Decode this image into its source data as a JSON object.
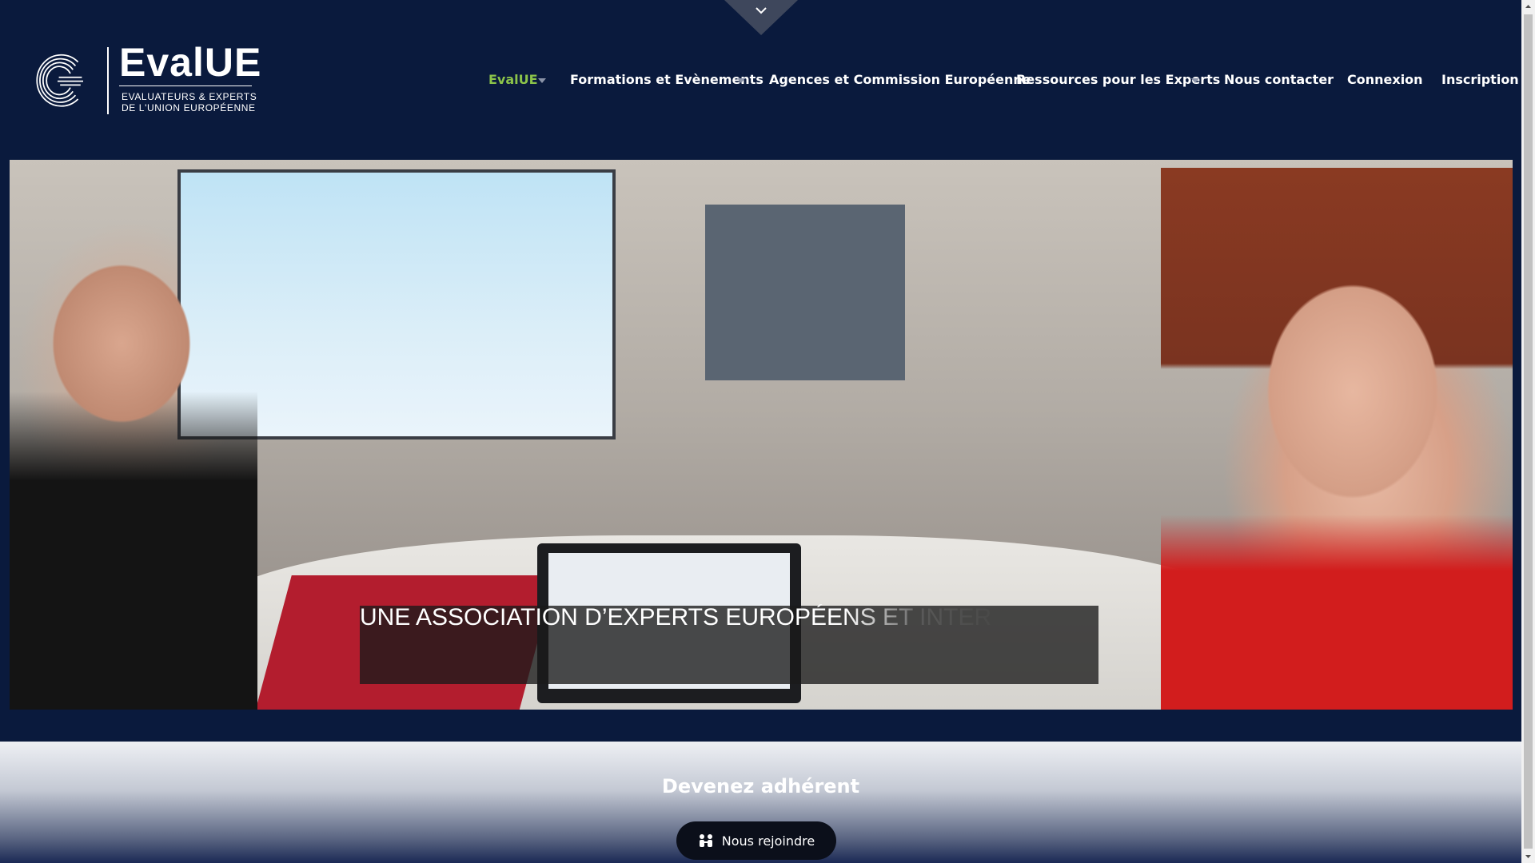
{
  "header": {
    "logo": {
      "name": "EvalUE",
      "line1": "EVALUATEURS & EXPERTS",
      "line2": "DE L'UNION EUROPÉENNE"
    },
    "nav": [
      {
        "label": "EvalUE",
        "active": true,
        "has_submenu": true
      },
      {
        "label": "Formations et Evènements",
        "active": false,
        "has_submenu": true
      },
      {
        "label": "Agences et Commission Européenne",
        "active": false,
        "has_submenu": false
      },
      {
        "label": "Ressources pour les Experts",
        "active": false,
        "has_submenu": true
      },
      {
        "label": "Nous contacter",
        "active": false,
        "has_submenu": false
      },
      {
        "label": "Connexion",
        "active": false,
        "has_submenu": false
      },
      {
        "label": "Inscription",
        "active": false,
        "has_submenu": false
      }
    ]
  },
  "hero": {
    "caption": "UNE ASSOCIATION D’EXPERTS EUROPÉENS ET INTER"
  },
  "join": {
    "title": "Devenez adhérent",
    "button_label": "Nous rejoindre"
  },
  "colors": {
    "background": "#0a1a3d",
    "active_nav": "#8bc34a",
    "button": "#0b0f1a"
  }
}
